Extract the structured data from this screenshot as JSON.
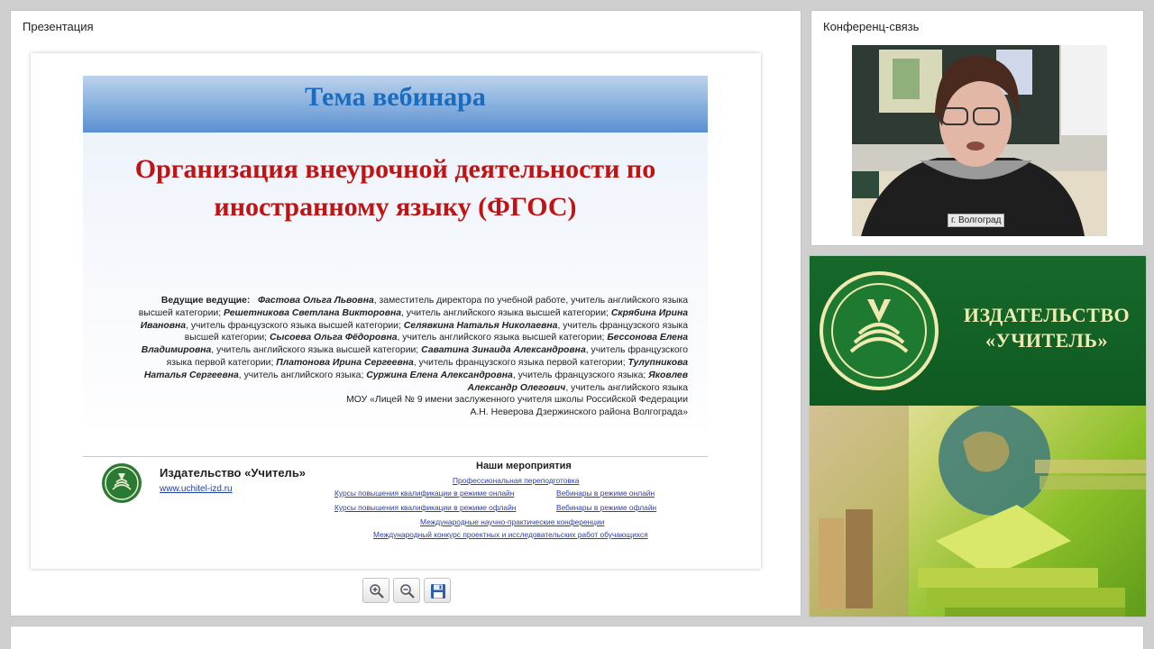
{
  "presentation": {
    "title": "Презентация",
    "slide": {
      "header": "Тема вебинара",
      "main_title": "Организация внеурочной деятельности по иностранному языку (ФГОС)",
      "hosts_lead": "Ведущие ведущие:",
      "hosts": [
        {
          "name": "Фастова Ольга Львовна",
          "role": ", заместитель директора по учебной работе, учитель английского языка высшей категории; "
        },
        {
          "name": "Решетникова Светлана Викторовна",
          "role": ", учитель английского языка высшей категории; "
        },
        {
          "name": "Скрябина Ирина Ивановна",
          "role": ", учитель французского языка высшей категории; "
        },
        {
          "name": "Селявкина Наталья Николаевна",
          "role": ", учитель французского языка высшей категории; "
        },
        {
          "name": "Сысоева Ольга Фёдоровна",
          "role": ", учитель английского языка высшей категории; "
        },
        {
          "name": "Бессонова Елена Владимировна",
          "role": ", учитель английского языка высшей категории; "
        },
        {
          "name": "Саватина Зинаида Александровна",
          "role": ", учитель французского языка первой категории; "
        },
        {
          "name": "Платонова Ирина Сергеевна",
          "role": ", учитель французского языка первой категории; "
        },
        {
          "name": "Тулупникова Наталья Сергеевна",
          "role": ", учитель английского языка; "
        },
        {
          "name": "Суржина Елена Александровна",
          "role": ", учитель французского языка; "
        },
        {
          "name": "Яковлев Александр Олегович",
          "role": ", учитель английского языка"
        }
      ],
      "school_line1": "МОУ «Лицей № 9 имени заслуженного учителя школы Российской Федерации",
      "school_line2": "А.Н. Неверова Дзержинского района Волгограда»",
      "footer": {
        "publisher": "Издательство «Учитель»",
        "url": "www.uchitel-izd.ru",
        "events_title": "Наши мероприятия",
        "links": {
          "retraining": "Профессиональная переподготовка",
          "courses_online": "Курсы повышения квалификации в режиме онлайн",
          "webinars_online": "Вебинары в режиме онлайн",
          "courses_offline": "Курсы повышения квалификации в режиме офлайн",
          "webinars_offline": "Вебинары в режиме офлайн",
          "conferences": "Международные научно-практические конференции",
          "contest": "Международный конкурс проектных и исследовательских работ обучающихся"
        }
      }
    },
    "toolbar": {
      "zoom_in_icon": "zoom-in-icon",
      "zoom_out_icon": "zoom-out-icon",
      "save_icon": "floppy-disk-icon"
    }
  },
  "conference": {
    "title": "Конференц-связь",
    "city_label": "г. Волгоград"
  },
  "promo": {
    "line1": "ИЗДАТЕЛЬСТВО",
    "line2": "«УЧИТЕЛЬ»",
    "colors": {
      "green": "#16692a",
      "text": "#f0eab0"
    }
  }
}
